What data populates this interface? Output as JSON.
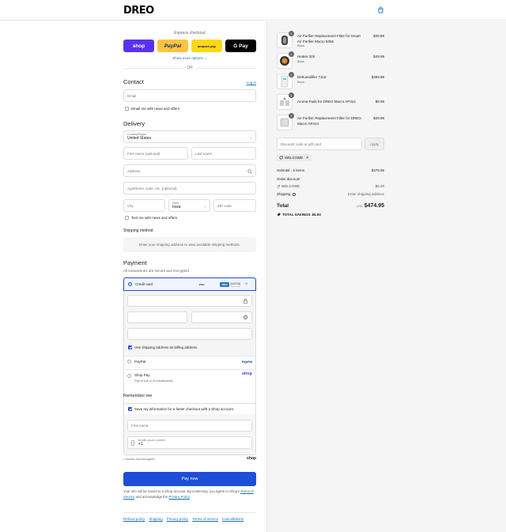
{
  "header": {
    "logo": "DREO",
    "cart_icon": "shopping-bag-icon"
  },
  "express": {
    "label": "Express checkout",
    "buttons": [
      {
        "label": "shop",
        "color": "#5a31f4",
        "text_color": "#ffffff"
      },
      {
        "label": "PayPal",
        "color": "#ffc439",
        "text_color": "#003087"
      },
      {
        "label": "amazon pay",
        "color": "#ffd814",
        "text_color": "#111111"
      },
      {
        "label": "G Pay",
        "color": "#000000",
        "text_color": "#ffffff"
      }
    ],
    "show_more": "Show more options ⌄",
    "or": "OR"
  },
  "contact": {
    "title": "Contact",
    "login": "Log in",
    "email_placeholder": "Email",
    "email_news": "Email me with news and offers"
  },
  "delivery": {
    "title": "Delivery",
    "country_label": "Country/Region",
    "country_value": "United States",
    "first_name": "First name (optional)",
    "last_name": "Last name",
    "address": "Address",
    "apartment": "Apartment, suite, etc. (optional)",
    "city": "City",
    "state_label": "State",
    "state_value": "Iowa",
    "zip": "ZIP code",
    "text_news": "Text me with news and offers"
  },
  "shipping": {
    "title": "Shipping method",
    "message": "Enter your shipping address to view available shipping methods."
  },
  "payment": {
    "title": "Payment",
    "subtitle": "All transactions are secure and encrypted.",
    "credit_card": "Credit card",
    "card_brands": [
      "VISA",
      "MC",
      "AMEX",
      "DISCOVER",
      "+4"
    ],
    "billing_same": "Use shipping address as billing address",
    "paypal": "PayPal",
    "shop_pay": "Shop Pay",
    "shop_pay_sub": "Pay in full or in installments"
  },
  "remember": {
    "title": "Remember me",
    "save_info": "Save my information for a faster checkout with a Shop account",
    "first_name": "First name",
    "phone_label": "Mobile phone number",
    "phone_value": "+1",
    "secure": "Secure and encrypted",
    "shop_logo": "shop"
  },
  "pay_now": "Pay now",
  "legal": {
    "text_a": "Your info will be saved to a Shop account. By continuing, you agree to Shop's",
    "terms": "Terms of Service",
    "text_b": "and acknowledge the",
    "privacy": "Privacy Policy",
    "period": "."
  },
  "footer_links": [
    "Refund policy",
    "Shipping",
    "Privacy policy",
    "Terms of service",
    "Cancellations"
  ],
  "cart": {
    "items": [
      {
        "name": "Air Purifier Replacement Filter for Smart Air Purifier Macro 5055",
        "variant": "Black",
        "price": "$29.99",
        "qty": "1"
      },
      {
        "name": "Heater 320",
        "variant": "Black",
        "price": "$49.99",
        "qty": "1"
      },
      {
        "name": "Dehumidifier 711S",
        "variant": "Black",
        "price": "$359.99",
        "qty": "1"
      },
      {
        "name": "Aroma Pads for DREO Macro AP314",
        "variant": "",
        "price": "$9.99",
        "qty": "1"
      },
      {
        "name": "Air Purifier Replacement Filter for DREO Macro AP314",
        "variant": "",
        "price": "$29.99",
        "qty": "1"
      }
    ],
    "discount_placeholder": "Discount code or gift card",
    "apply": "Apply",
    "applied_code": "WELCOME",
    "subtotal_label": "Subtotal · 5 items",
    "subtotal": "$479.95",
    "order_discount": "Order discount",
    "discount_code": "WELCOME",
    "discount_amount": "- $5.00",
    "shipping_label": "Shipping",
    "shipping_value": "Enter shipping address",
    "total_label": "Total",
    "currency": "USD",
    "total": "$474.95",
    "savings_label": "TOTAL SAVINGS",
    "savings": "$5.00"
  },
  "colors": {
    "accent": "#1c4ed8",
    "link": "#1773b0",
    "panel": "#f5f5f5"
  }
}
